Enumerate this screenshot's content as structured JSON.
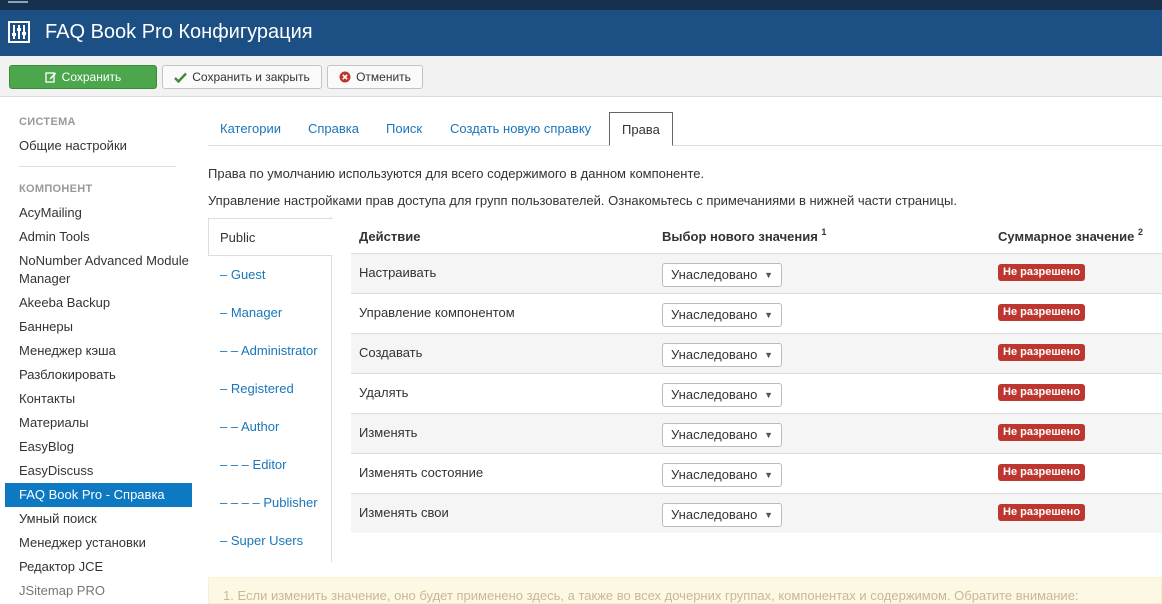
{
  "header": {
    "title": "FAQ Book Pro Конфигурация",
    "icon": "equalizer-icon"
  },
  "toolbar": {
    "save_label": "Сохранить",
    "save_close_label": "Сохранить и закрыть",
    "cancel_label": "Отменить"
  },
  "sidebar": {
    "section_system": "СИСТЕМА",
    "general_settings": "Общие настройки",
    "section_component": "КОМПОНЕНТ",
    "items": [
      "AcyMailing",
      "Admin Tools",
      "NoNumber Advanced Module Manager",
      "Akeeba Backup",
      "Баннеры",
      "Менеджер кэша",
      "Разблокировать",
      "Контакты",
      "Материалы",
      "EasyBlog",
      "EasyDiscuss",
      "FAQ Book Pro - Справка",
      "Умный поиск",
      "Менеджер установки",
      "Редактор JCE",
      "JSitemap PRO"
    ],
    "active_index": 11
  },
  "tabs": [
    {
      "label": "Категории"
    },
    {
      "label": "Справка"
    },
    {
      "label": "Поиск"
    },
    {
      "label": "Создать новую справку"
    },
    {
      "label": "Права"
    }
  ],
  "active_tab": 4,
  "notes": {
    "line1": "Права по умолчанию используются для всего содержимого в данном компоненте.",
    "line2": "Управление настройками прав доступа для групп пользователей. Ознакомьтесь с примечаниями в нижней части страницы."
  },
  "groups": [
    "Public",
    "– Guest",
    "– Manager",
    "– – Administrator",
    "– Registered",
    "– – Author",
    "– – – Editor",
    "– – – – Publisher",
    "– Super Users"
  ],
  "active_group": 0,
  "permissions": {
    "col_action": "Действие",
    "col_new_value": "Выбор нового значения",
    "col_new_value_sup": "1",
    "col_calculated": "Суммарное значение",
    "col_calculated_sup": "2",
    "rows": [
      {
        "action": "Настраивать",
        "select": "Унаследовано",
        "result": "Не разрешено"
      },
      {
        "action": "Управление компонентом",
        "select": "Унаследовано",
        "result": "Не разрешено"
      },
      {
        "action": "Создавать",
        "select": "Унаследовано",
        "result": "Не разрешено"
      },
      {
        "action": "Удалять",
        "select": "Унаследовано",
        "result": "Не разрешено"
      },
      {
        "action": "Изменять",
        "select": "Унаследовано",
        "result": "Не разрешено"
      },
      {
        "action": "Изменять состояние",
        "select": "Унаследовано",
        "result": "Не разрешено"
      },
      {
        "action": "Изменять свои",
        "select": "Унаследовано",
        "result": "Не разрешено"
      }
    ]
  },
  "footnote": "1. Если изменить значение, оно будет применено здесь, а также во всех дочерних группах, компонентах и содержимом. Обратите внимание:",
  "colors": {
    "header_bg": "#1c4f83",
    "save_green": "#4ca64b",
    "link_blue": "#1a76b9",
    "active_sidebar": "#0e79c3",
    "badge_red": "#bd362f"
  }
}
